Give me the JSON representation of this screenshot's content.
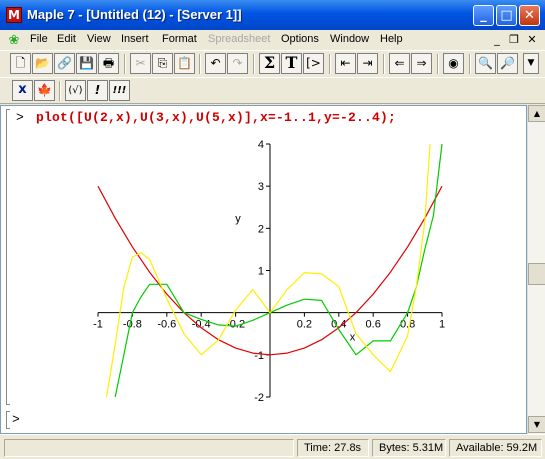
{
  "window": {
    "title": "Maple 7  - [Untitled (12) - [Server 1]]",
    "app_icon": "maple-app-icon",
    "controls": {
      "minimize": "_",
      "maximize": "□",
      "close": "✕"
    }
  },
  "menubar": {
    "items": [
      {
        "label": "File",
        "enabled": true
      },
      {
        "label": "Edit",
        "enabled": true
      },
      {
        "label": "View",
        "enabled": true
      },
      {
        "label": "Insert",
        "enabled": true
      },
      {
        "label": "Format",
        "enabled": true
      },
      {
        "label": "Spreadsheet",
        "enabled": false
      },
      {
        "label": "Options",
        "enabled": true
      },
      {
        "label": "Window",
        "enabled": true
      },
      {
        "label": "Help",
        "enabled": true
      }
    ],
    "mdi_controls": {
      "minimize": "_",
      "restore": "❐",
      "close": "✕"
    }
  },
  "toolbar": {
    "row1": [
      {
        "name": "new-icon",
        "glyph": "🗋"
      },
      {
        "name": "open-icon",
        "glyph": "📂"
      },
      {
        "name": "open-url-icon",
        "glyph": "🔗"
      },
      {
        "name": "save-icon",
        "glyph": "💾"
      },
      {
        "name": "print-icon",
        "glyph": "🖶"
      },
      {
        "name": "cut-icon",
        "glyph": "✂"
      },
      {
        "name": "copy-icon",
        "glyph": "⎘"
      },
      {
        "name": "paste-icon",
        "glyph": "📋"
      },
      {
        "name": "undo-icon",
        "glyph": "↶"
      },
      {
        "name": "redo-icon",
        "glyph": "↷"
      },
      {
        "name": "math-input-icon",
        "glyph": "Σ"
      },
      {
        "name": "text-input-icon",
        "glyph": "T"
      },
      {
        "name": "execution-group-icon",
        "glyph": "[>"
      },
      {
        "name": "outdent-icon",
        "glyph": "⇤"
      },
      {
        "name": "indent-icon",
        "glyph": "⇥"
      },
      {
        "name": "back-icon",
        "glyph": "⇐"
      },
      {
        "name": "forward-icon",
        "glyph": "⇒"
      },
      {
        "name": "stop-icon",
        "glyph": "◉"
      },
      {
        "name": "zoom-in-icon",
        "glyph": "🔍"
      },
      {
        "name": "zoom-out-icon",
        "glyph": "🔎"
      }
    ],
    "row2": [
      {
        "name": "math-mode-x-icon",
        "glyph": "x"
      },
      {
        "name": "maple-leaf-icon",
        "glyph": "🍁"
      },
      {
        "name": "check-syntax-icon",
        "glyph": "(√)"
      },
      {
        "name": "execute-icon",
        "glyph": "!"
      },
      {
        "name": "execute-all-icon",
        "glyph": "!!!"
      }
    ]
  },
  "worksheet": {
    "prompt_symbol": ">",
    "command": "plot([U(2,x),U(3,x),U(5,x)],x=-1..1,y=-2..4);",
    "empty_prompt": ">"
  },
  "chart_data": {
    "type": "line",
    "title": "",
    "xlabel": "x",
    "ylabel": "y",
    "xlim": [
      -1,
      1
    ],
    "ylim": [
      -2,
      4
    ],
    "x_ticks": [
      "-1",
      "-0.8",
      "-0.6",
      "-0.4",
      "-0.2",
      "0.2",
      "0.4",
      "0.6",
      "0.8",
      "1"
    ],
    "y_ticks": [
      "-2",
      "-1",
      "1",
      "2",
      "3",
      "4"
    ],
    "x_tick_values": [
      -1,
      -0.8,
      -0.6,
      -0.4,
      -0.2,
      0.2,
      0.4,
      0.6,
      0.8,
      1
    ],
    "y_tick_values": [
      -2,
      -1,
      1,
      2,
      3,
      4
    ],
    "grid": false,
    "series": [
      {
        "color": "#e00000",
        "x": [
          -1,
          -0.9,
          -0.8,
          -0.7,
          -0.6,
          -0.5,
          -0.4,
          -0.3,
          -0.2,
          -0.1,
          0,
          0.1,
          0.2,
          0.3,
          0.4,
          0.5,
          0.6,
          0.7,
          0.8,
          0.9,
          1
        ],
        "y": [
          3,
          2.24,
          1.56,
          0.96,
          0.44,
          0,
          -0.36,
          -0.64,
          -0.84,
          -0.96,
          -1,
          -0.96,
          -0.84,
          -0.64,
          -0.36,
          0,
          0.44,
          0.96,
          1.56,
          2.24,
          3
        ]
      },
      {
        "color": "#00cc00",
        "x": [
          -0.9,
          -0.85,
          -0.8,
          -0.75,
          -0.7,
          -0.6,
          -0.5,
          -0.4,
          -0.3,
          -0.2,
          -0.1,
          0,
          0.1,
          0.2,
          0.3,
          0.4,
          0.5,
          0.6,
          0.7,
          0.8,
          0.85,
          0.9,
          0.95,
          1
        ],
        "y": [
          -2.232,
          -1.006,
          0,
          0.375,
          0.672,
          0.672,
          0,
          -0.16,
          -0.29,
          -0.32,
          -0.18,
          0,
          0.18,
          0.32,
          0.29,
          -0.4,
          -1,
          -0.67,
          -0.67,
          0,
          0.6,
          1.5,
          2.3,
          4
        ]
      },
      {
        "color": "#ffee00",
        "x": [
          -0.95,
          -0.9,
          -0.85,
          -0.8,
          -0.75,
          -0.7,
          -0.6,
          -0.5,
          -0.4,
          -0.3,
          -0.2,
          -0.1,
          0,
          0.1,
          0.2,
          0.3,
          0.4,
          0.5,
          0.6,
          0.7,
          0.8,
          0.85,
          0.9,
          0.93
        ],
        "y": [
          -2,
          -0.75,
          0.6,
          1.32,
          1.42,
          1.26,
          0.33,
          -0.5,
          -1.0,
          -0.65,
          0.06,
          0.55,
          0,
          0.55,
          0.95,
          0.92,
          0.62,
          -0.5,
          -1.0,
          -1.4,
          -0.55,
          0.6,
          2.16,
          4
        ]
      }
    ]
  },
  "status": {
    "time": "Time:  27.8s",
    "bytes": "Bytes: 5.31M",
    "available": "Available: 59.2M"
  }
}
